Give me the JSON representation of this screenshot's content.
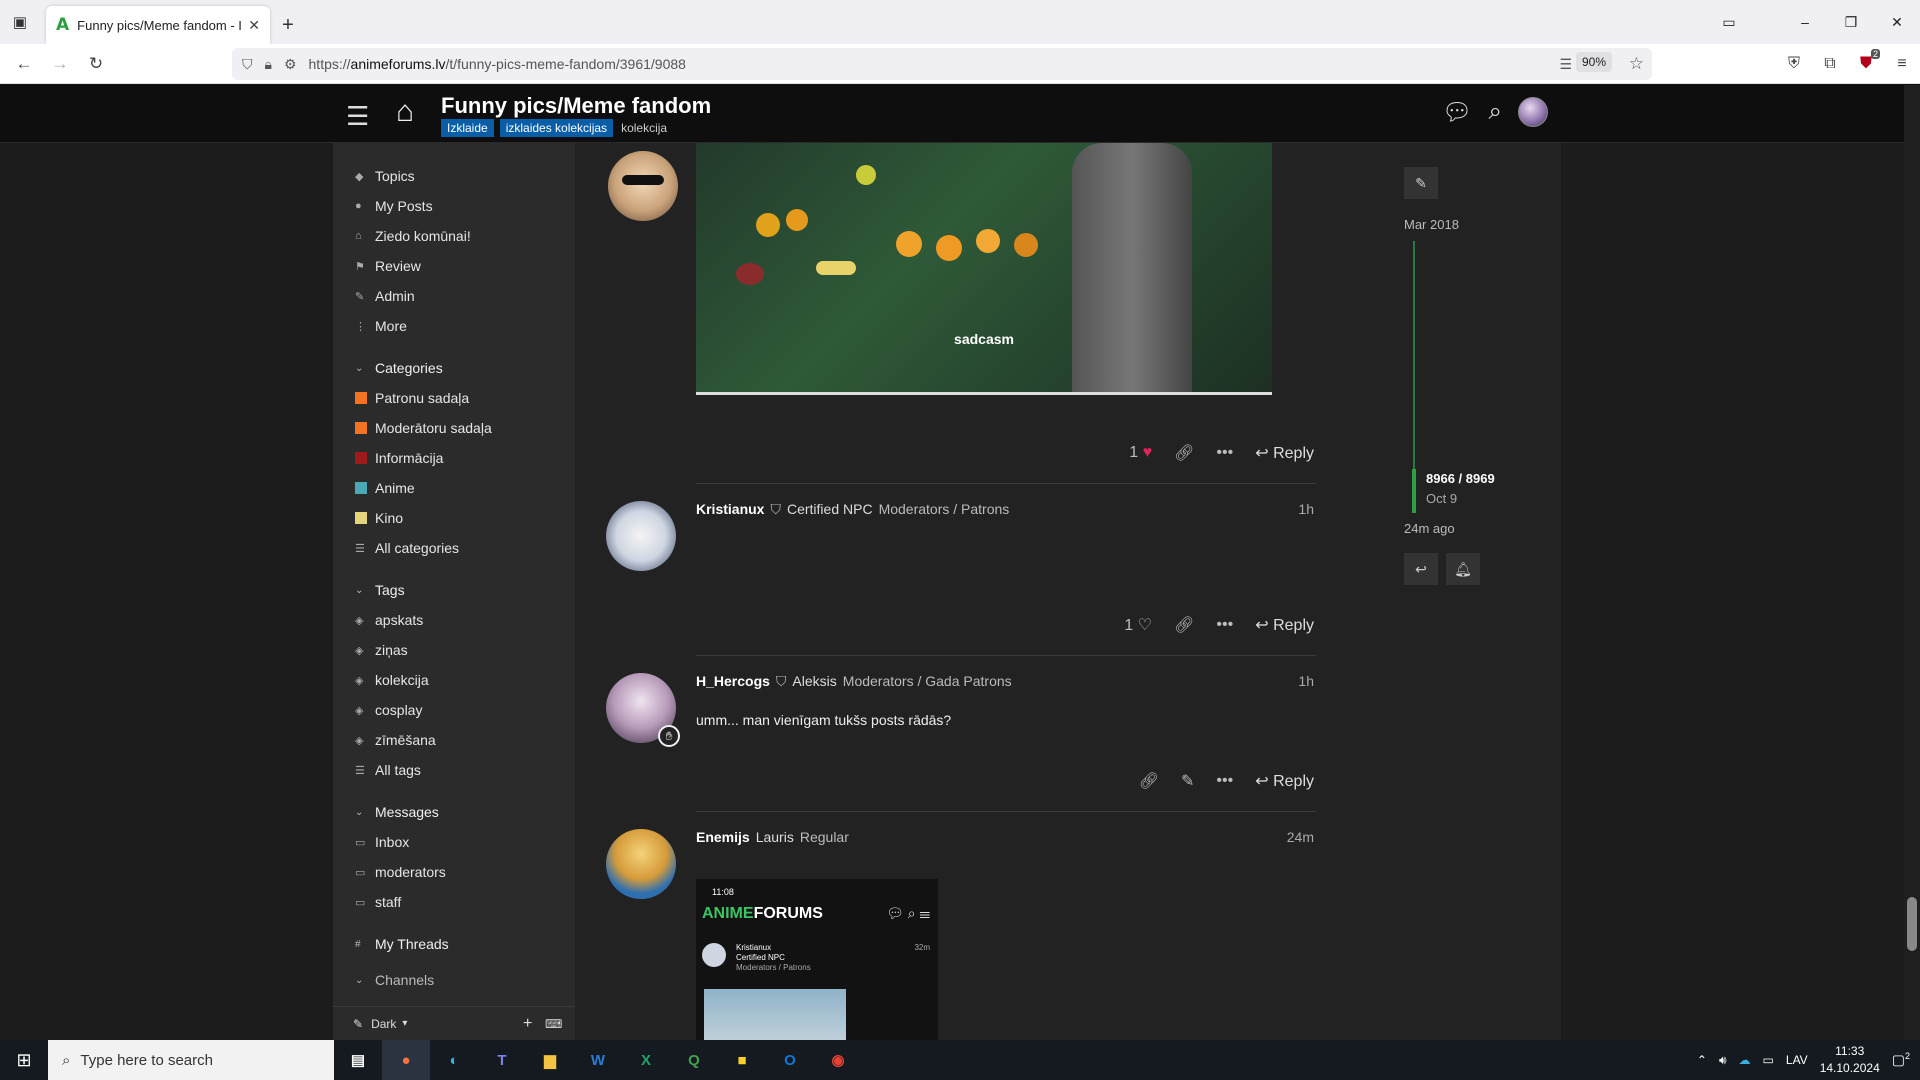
{
  "browser": {
    "tab_title": "Funny pics/Meme fandom - Izk",
    "url_prefix": "https://",
    "url_host": "animeforums.lv",
    "url_path": "/t/funny-pics-meme-fandom/3961/9088",
    "zoom": "90%",
    "extension_badge": "2"
  },
  "site": {
    "topic_title": "Funny pics/Meme fandom",
    "tags": [
      "Izklaide",
      "izklaides kolekcijas",
      "kolekcija"
    ]
  },
  "sidebar": {
    "nav": [
      {
        "icon": "stack-icon",
        "label": "Topics"
      },
      {
        "icon": "user-icon",
        "label": "My Posts"
      },
      {
        "icon": "home-icon",
        "label": "Ziedo komūnai!"
      },
      {
        "icon": "flag-icon",
        "label": "Review"
      },
      {
        "icon": "wrench-icon",
        "label": "Admin"
      },
      {
        "icon": "more-icon",
        "label": "More"
      }
    ],
    "categories_heading": "Categories",
    "categories": [
      {
        "label": "Patronu sadaļa",
        "color": "#f47321"
      },
      {
        "label": "Moderātoru sadaļa",
        "color": "#f47321"
      },
      {
        "label": "Informācija",
        "color": "#9e1b1b"
      },
      {
        "label": "Anime",
        "color": "#49a7b8"
      },
      {
        "label": "Kino",
        "color": "#e4d57a"
      },
      {
        "label": "All categories",
        "color": ""
      }
    ],
    "tags_heading": "Tags",
    "tags": [
      "apskats",
      "ziņas",
      "kolekcija",
      "cosplay",
      "zīmēšana",
      "All tags"
    ],
    "messages_heading": "Messages",
    "messages": [
      "Inbox",
      "moderators",
      "staff"
    ],
    "my_threads": "My Threads",
    "channels": "Channels",
    "theme": "Dark"
  },
  "posts": [
    {
      "caption": "sadcasm",
      "likes": "1",
      "reply_label": "Reply"
    },
    {
      "username": "Kristianux",
      "title": "Certified NPC",
      "groups": "Moderators / Patrons",
      "time": "1h",
      "body": "",
      "likes": "1",
      "reply_label": "Reply"
    },
    {
      "username": "H_Hercogs",
      "title": "Aleksis",
      "groups": "Moderators / Gada Patrons",
      "time": "1h",
      "body": "umm... man vienīgam tukšs posts rādās?",
      "reply_label": "Reply"
    },
    {
      "username": "Enemijs",
      "title": "Lauris",
      "groups": "Regular",
      "time": "24m",
      "embed": {
        "time": "11:08",
        "brand": "ANIMEFORUMS",
        "user": "Kristianux",
        "user_title": "Certified NPC",
        "user_groups": "Moderators / Patrons",
        "ago": "32m"
      }
    }
  ],
  "timeline": {
    "start": "Mar 2018",
    "position": "8966 / 8969",
    "date": "Oct 9",
    "ago": "24m ago"
  },
  "taskbar": {
    "search_placeholder": "Type here to search",
    "lang": "LAV",
    "time": "11:33",
    "date": "14.10.2024",
    "notifications": "2"
  }
}
